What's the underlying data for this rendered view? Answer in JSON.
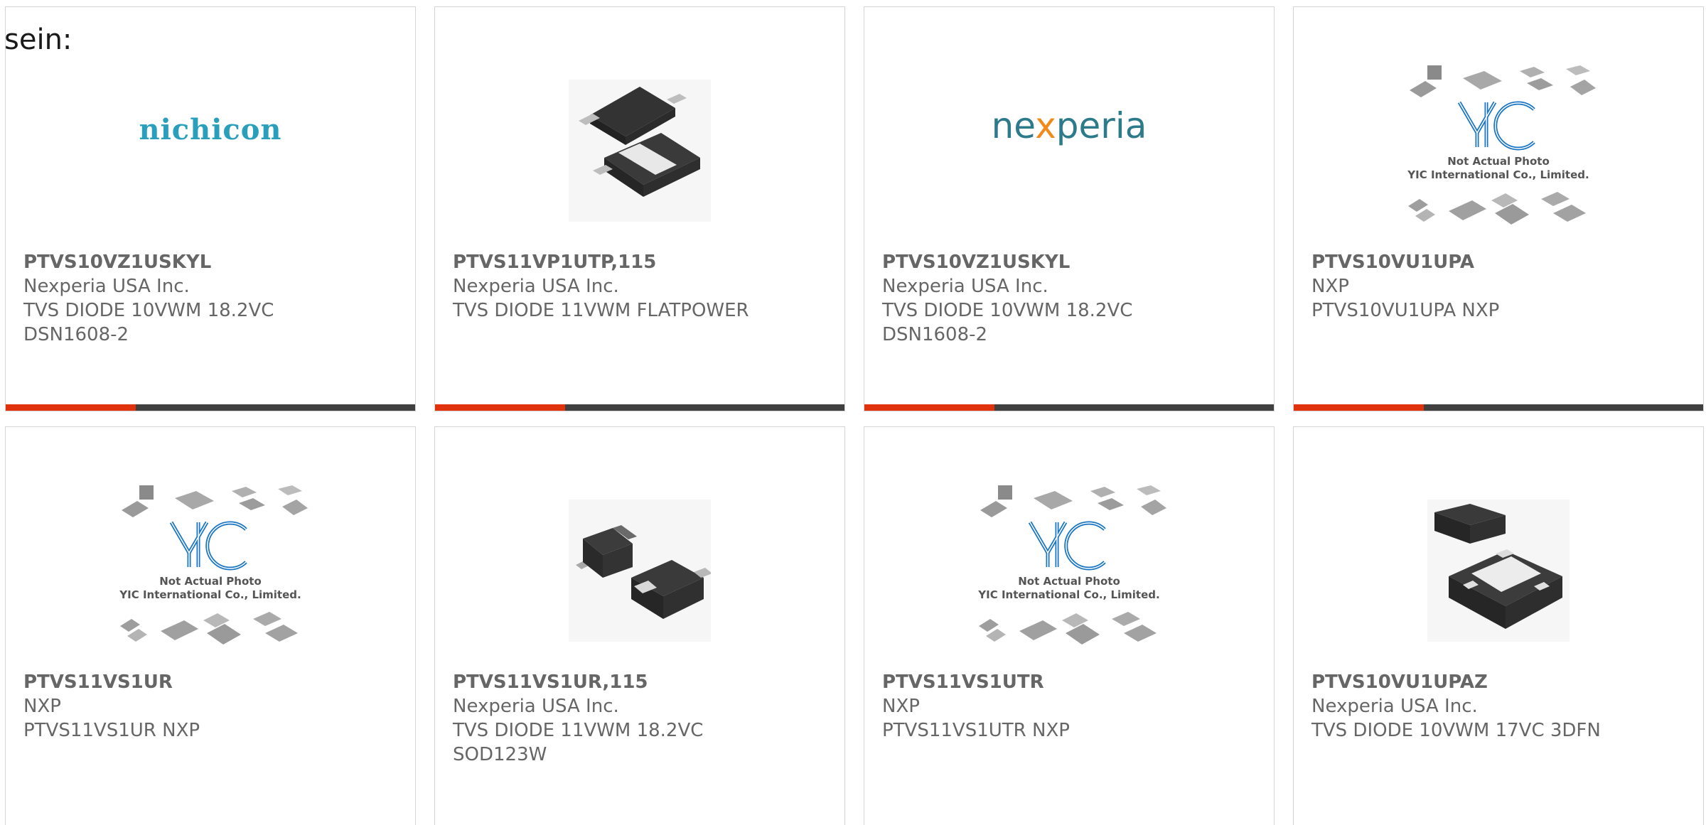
{
  "intro_text": "sein:",
  "colors": {
    "accent": "#e0330d",
    "bar": "#404040",
    "text": "#666666",
    "border": "#d4d4d4",
    "yic_blue": "#1a76c4"
  },
  "placeholder": {
    "line1": "Not Actual Photo",
    "line2": "YIC International Co., Limited."
  },
  "brand_logos": {
    "nichicon": "nichicon",
    "nexperia_pre": "ne",
    "nexperia_x": "x",
    "nexperia_post": "peria"
  },
  "products": [
    {
      "image": "nichicon-logo",
      "part": "PTVS10VZ1USKYL",
      "manufacturer": "Nexperia USA Inc.",
      "description": "TVS DIODE 10VWM 18.2VC",
      "package": "DSN1608-2"
    },
    {
      "image": "flatpower-diode-photo",
      "part": "PTVS11VP1UTP,115",
      "manufacturer": "Nexperia USA Inc.",
      "description": "TVS DIODE 11VWM FLATPOWER",
      "package": ""
    },
    {
      "image": "nexperia-logo",
      "part": "PTVS10VZ1USKYL",
      "manufacturer": "Nexperia USA Inc.",
      "description": "TVS DIODE 10VWM 18.2VC",
      "package": "DSN1608-2"
    },
    {
      "image": "yic-placeholder",
      "part": "PTVS10VU1UPA",
      "manufacturer": "NXP",
      "description": "PTVS10VU1UPA NXP",
      "package": ""
    },
    {
      "image": "yic-placeholder",
      "part": "PTVS11VS1UR",
      "manufacturer": "NXP",
      "description": "PTVS11VS1UR NXP",
      "package": ""
    },
    {
      "image": "sod123w-diode-photo",
      "part": "PTVS11VS1UR,115",
      "manufacturer": "Nexperia USA Inc.",
      "description": "TVS DIODE 11VWM 18.2VC",
      "package": "SOD123W"
    },
    {
      "image": "yic-placeholder",
      "part": "PTVS11VS1UTR",
      "manufacturer": "NXP",
      "description": "PTVS11VS1UTR NXP",
      "package": ""
    },
    {
      "image": "dfn-package-photo",
      "part": "PTVS10VU1UPAZ",
      "manufacturer": "Nexperia USA Inc.",
      "description": "TVS DIODE 10VWM 17VC 3DFN",
      "package": ""
    }
  ]
}
